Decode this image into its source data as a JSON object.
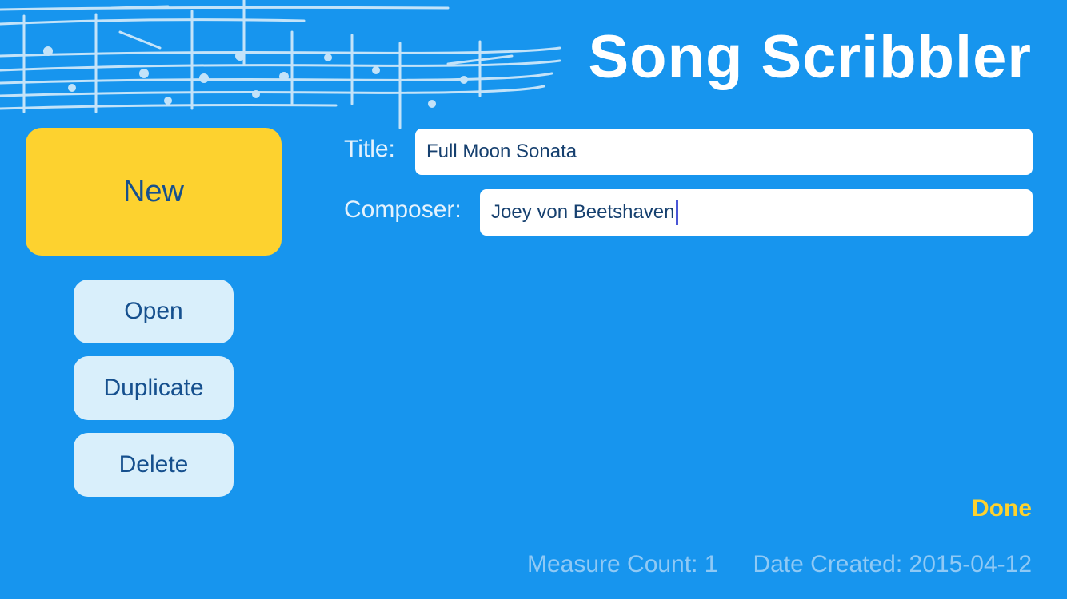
{
  "header": {
    "title": "Song Scribbler"
  },
  "actions": {
    "new_label": "New",
    "open_label": "Open",
    "duplicate_label": "Duplicate",
    "delete_label": "Delete"
  },
  "form": {
    "title_label": "Title:",
    "title_value": "Full Moon Sonata",
    "composer_label": "Composer:",
    "composer_value": "Joey von Beetshaven"
  },
  "done_label": "Done",
  "footer": {
    "measure_count": "Measure Count: 1",
    "date_created": "Date Created: 2015-04-12"
  },
  "colors": {
    "background": "#1795ee",
    "new_button": "#fdd22f",
    "secondary_button": "#d9effb",
    "button_text": "#16508e",
    "done": "#fdd22f"
  }
}
